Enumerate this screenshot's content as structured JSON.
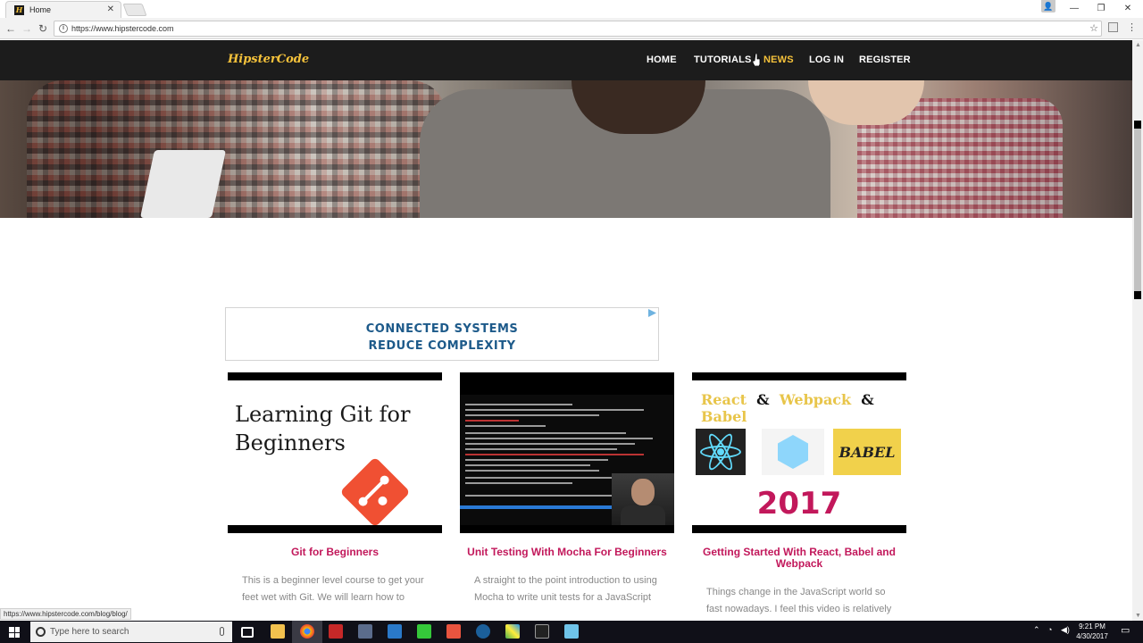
{
  "browser": {
    "tab_title": "Home",
    "tab_favicon": "H",
    "url": "https://www.hipstercode.com",
    "status_url": "https://www.hipstercode.com/blog/blog/"
  },
  "site": {
    "logo": "HipsterCode",
    "nav": [
      "HOME",
      "TUTORIALS",
      "NEWS",
      "LOG IN",
      "REGISTER"
    ],
    "active_nav": "NEWS",
    "accent": "#f5c23b"
  },
  "ad": {
    "line1": "CONNECTED SYSTEMS",
    "line2": "REDUCE COMPLEXITY"
  },
  "cards": [
    {
      "title": "Git for Beginners",
      "thumb_text": "Learning Git for Beginners",
      "desc": "This is a beginner level course to get your feet wet with Git. We will learn how to"
    },
    {
      "title": "Unit Testing With Mocha For Beginners",
      "desc": "A straight to the point introduction to using Mocha to write unit tests for a JavaScript"
    },
    {
      "title": "Getting Started With React, Babel and Webpack",
      "thumb_react": "React",
      "thumb_webpack": "Webpack",
      "thumb_babel": "Babel",
      "thumb_amp": "&",
      "thumb_babel_logo": "BABEL",
      "thumb_year": "2017",
      "desc": "Things change in the JavaScript world so fast nowadays. I feel this video is relatively"
    }
  ],
  "taskbar": {
    "search_placeholder": "Type here to search",
    "time": "9:21 PM",
    "date": "4/30/2017"
  },
  "colors": {
    "card_title": "#c2185b",
    "nav_bg": "#1c1c1c",
    "ad_text": "#1d5a8a"
  }
}
